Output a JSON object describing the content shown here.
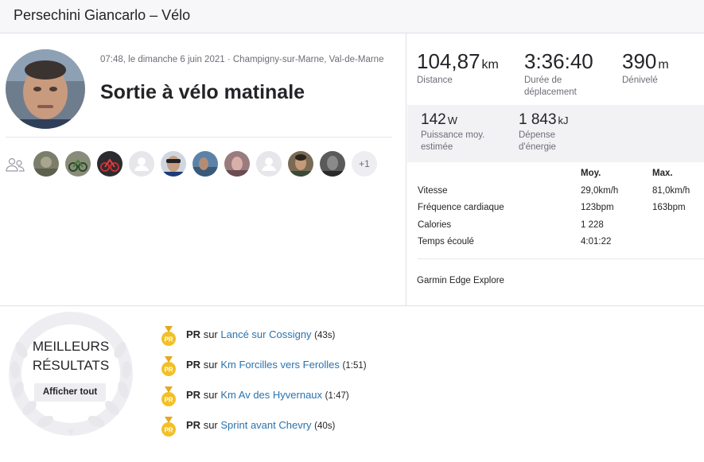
{
  "header": {
    "title": "Persechini Giancarlo – Vélo"
  },
  "activity": {
    "meta": "07:48, le dimanche 6 juin 2021 · Champigny-sur-Marne, Val-de-Marne",
    "title": "Sortie à vélo matinale"
  },
  "athletes": {
    "more_label": "+1"
  },
  "stats": {
    "distance": {
      "value": "104,87",
      "unit": "km",
      "label": "Distance"
    },
    "moving_time": {
      "value": "3:36:40",
      "label": "Durée de déplacement"
    },
    "elevation": {
      "value": "390",
      "unit": "m",
      "label": "Dénivelé"
    },
    "power": {
      "value": "142",
      "unit": "W",
      "label": "Puissance moy. estimée"
    },
    "energy": {
      "value": "1 843",
      "unit": "kJ",
      "label": "Dépense d'énergie"
    }
  },
  "table": {
    "col_avg": "Moy.",
    "col_max": "Max.",
    "rows": [
      {
        "label": "Vitesse",
        "avg": "29,0km/h",
        "max": "81,0km/h"
      },
      {
        "label": "Fréquence cardiaque",
        "avg": "123bpm",
        "max": "163bpm"
      },
      {
        "label": "Calories",
        "avg": "1 228",
        "max": ""
      },
      {
        "label": "Temps écoulé",
        "avg": "4:01:22",
        "max": ""
      }
    ]
  },
  "device": "Garmin Edge Explore",
  "achievements": {
    "title_line1": "MEILLEURS",
    "title_line2": "RÉSULTATS",
    "button": "Afficher tout",
    "items": [
      {
        "prefix": "PR",
        "sur": "sur",
        "segment": "Lancé sur Cossigny",
        "time": "(43s)"
      },
      {
        "prefix": "PR",
        "sur": "sur",
        "segment": "Km Forcilles vers Ferolles",
        "time": "(1:51)"
      },
      {
        "prefix": "PR",
        "sur": "sur",
        "segment": "Km Av des Hyvernaux",
        "time": "(1:47)"
      },
      {
        "prefix": "PR",
        "sur": "sur",
        "segment": "Sprint avant Chevry",
        "time": "(40s)"
      }
    ]
  },
  "colors": {
    "link": "#2b73ad",
    "medal": "#f2c025",
    "accent": "#fc4c02"
  },
  "icons": {
    "group": "group-icon",
    "medal": "medal-icon",
    "laurel": "laurel-icon"
  }
}
